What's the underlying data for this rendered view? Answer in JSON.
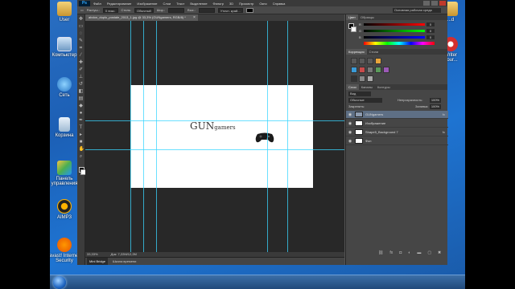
{
  "desktop": {
    "icons": [
      {
        "label": "User",
        "icon": "user-folder-icon"
      },
      {
        "label": "Компьютер",
        "icon": "computer-icon"
      },
      {
        "label": "Сеть",
        "icon": "network-icon"
      },
      {
        "label": "Корзина",
        "icon": "recycle-bin-icon"
      },
      {
        "label": "Панель управления",
        "icon": "control-panel-icon"
      },
      {
        "label": "AIMP3",
        "icon": "aimp-icon"
      },
      {
        "label": "avast! Internet Security",
        "icon": "avast-icon"
      }
    ],
    "right_icons": [
      {
        "label": "...d",
        "icon": "folder-icon"
      },
      {
        "label": "Writer",
        "icon": "writer-icon"
      },
      {
        "label": "Sour...",
        "icon": "source-icon"
      }
    ]
  },
  "photoshop": {
    "logo": "Ps",
    "menu": [
      "Файл",
      "Редактирование",
      "Изображение",
      "Слои",
      "Текст",
      "Выделение",
      "Фильтр",
      "3D",
      "Просмотр",
      "Окно",
      "Справка"
    ],
    "options": {
      "feather_label": "Растуш.:",
      "feather_value": "0 пикс.",
      "style_label": "Стиль:",
      "style_value": "Обычный",
      "width_label": "Шир.:",
      "height_label": "Выс.:",
      "refine_label": "Уточн. край...",
      "workspace": "Основная рабочая среда"
    },
    "document": {
      "tab_title": "abdon_duplo_postale_2013_1.jpg @ 33,3% (GUNgamers, RGB/8) *",
      "logo_main": "GUN",
      "logo_small": "gamers",
      "zoom": "33,33%",
      "doc_size": "Док: 7,22M/12,2M"
    },
    "bottom_tabs": [
      "Mini Bridge",
      "Шкала времени"
    ],
    "panels": {
      "color_tabs": [
        "Цвет",
        "Образцы"
      ],
      "color_labels": [
        "R",
        "G",
        "B"
      ],
      "color_values": [
        "0",
        "0",
        "0"
      ],
      "adjust_tabs": [
        "Коррекция",
        "Стили"
      ],
      "layer_tabs": [
        "Слои",
        "Каналы",
        "Контуры"
      ],
      "kind_label": "Вид",
      "blend_mode": "Обычные",
      "opacity_label": "Непрозрачность:",
      "opacity_value": "100%",
      "lock_label": "Закрепить:",
      "fill_label": "Заливка:",
      "fill_value": "100%",
      "layers": [
        {
          "name": "GUNgamers",
          "selected": true
        },
        {
          "name": "Изображение",
          "selected": false
        },
        {
          "name": "Shape5_Background 7",
          "selected": false
        },
        {
          "name": "Фон",
          "selected": false
        }
      ]
    }
  }
}
